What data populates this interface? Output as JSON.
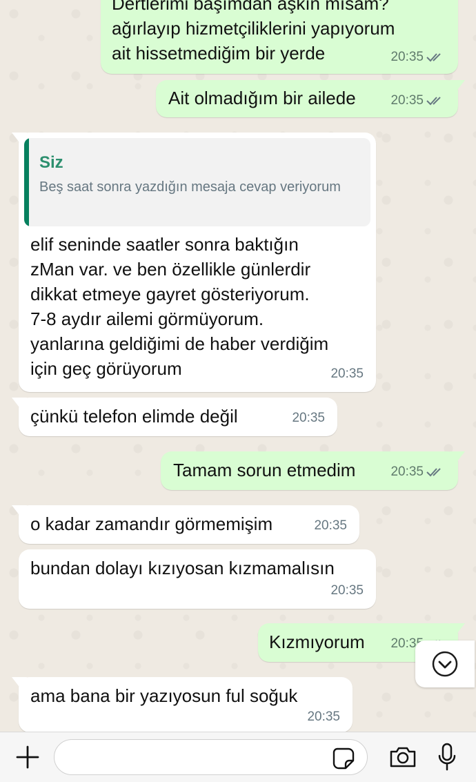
{
  "messages": [
    {
      "id": "m1",
      "direction": "out",
      "text": "Dertlerimi başımdan aşkın mısam?\nağırlayıp hizmetçiliklerini yapıyorum\nait hissetmediğim bir yerde",
      "time": "20:35",
      "status": "read"
    },
    {
      "id": "m2",
      "direction": "out",
      "text": "Ait olmadığım bir ailede",
      "time": "20:35",
      "status": "read"
    },
    {
      "id": "m3",
      "direction": "in",
      "quote": {
        "author": "Siz",
        "text": "Beş saat sonra yazdığın mesaja cevap veriyorum"
      },
      "text": "elif seninde saatler sonra baktığın\nzMan var. ve ben özellikle günlerdir\ndikkat etmeye gayret gösteriyorum.\n7-8 aydır ailemi görmüyorum.\nyanlarına geldiğimi de haber verdiğim\niçin geç görüyorum",
      "time": "20:35"
    },
    {
      "id": "m4",
      "direction": "in",
      "text": "çünkü telefon elimde değil",
      "time": "20:35"
    },
    {
      "id": "m5",
      "direction": "out",
      "text": "Tamam sorun etmedim",
      "time": "20:35",
      "status": "read"
    },
    {
      "id": "m6",
      "direction": "in",
      "text": "o kadar zamandır görmemişim",
      "time": "20:35"
    },
    {
      "id": "m7",
      "direction": "in",
      "text": "bundan dolayı kızıyosan kızmamalısın",
      "time": "20:35"
    },
    {
      "id": "m8",
      "direction": "out",
      "text": "Kızmıyorum",
      "time": "20:35",
      "status": "read"
    },
    {
      "id": "m9",
      "direction": "in",
      "text": "ama bana bir yazıyosun ful soğuk",
      "time": "20:35"
    }
  ],
  "composer": {
    "input_value": "",
    "icons": [
      "plus-icon",
      "sticker-icon",
      "camera-icon",
      "microphone-icon"
    ]
  },
  "scroll_button_icon": "chevron-down-icon",
  "colors": {
    "outgoing_bubble": "#d9fdd3",
    "incoming_bubble": "#ffffff",
    "chat_background": "#efeae2",
    "quote_accent": "#06805e",
    "timestamp": "#667781"
  }
}
